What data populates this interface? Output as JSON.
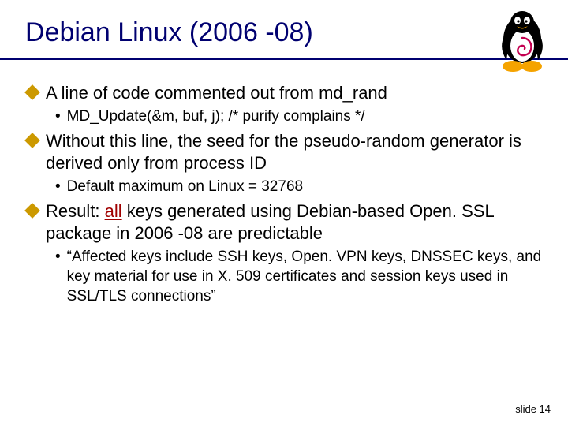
{
  "title": "Debian Linux (2006 -08)",
  "bullets": {
    "b1": "A line of code commented out from md_rand",
    "b1a": "MD_Update(&m, buf, j);  /* purify complains */",
    "b2": "Without this line, the seed for the pseudo-random generator is derived only from process ID",
    "b2a": "Default maximum on Linux = 32768",
    "b3_prefix": "Result: ",
    "b3_all": "all",
    "b3_rest": " keys generated using Debian-based Open. SSL package in 2006 -08 are predictable",
    "b3a": "“Affected keys include SSH keys, Open. VPN keys, DNSSEC keys, and key material for use in X. 509 certificates and session keys used in SSL/TLS connections”"
  },
  "footer": "slide 14"
}
